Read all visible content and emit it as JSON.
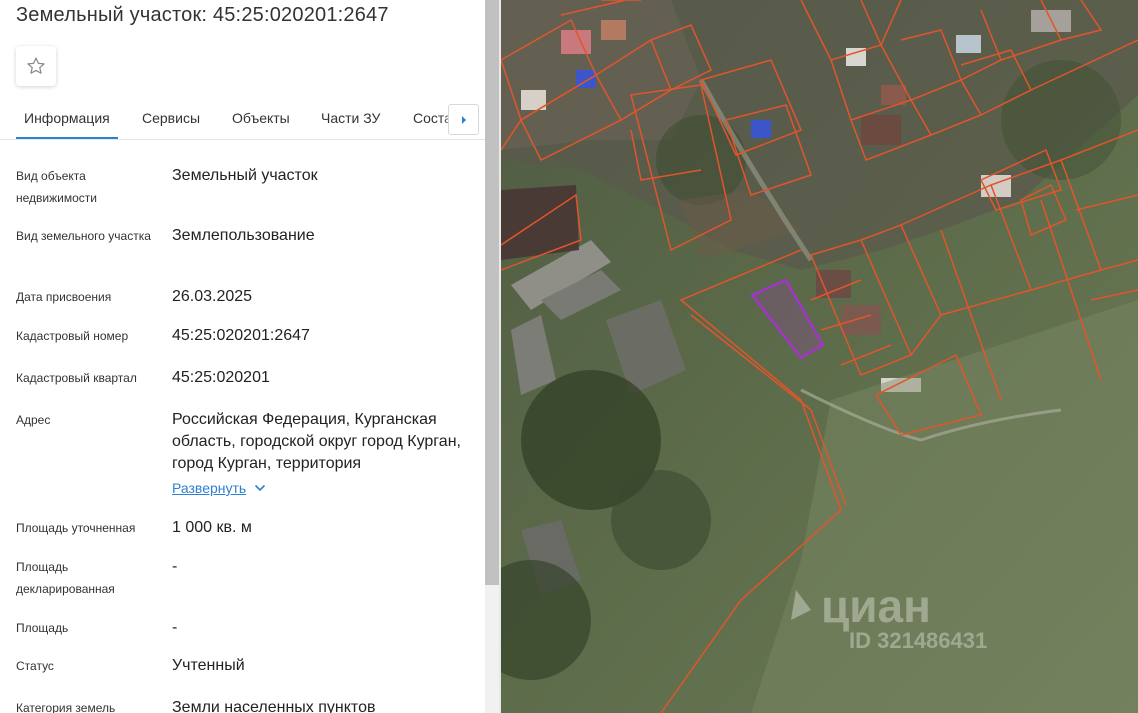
{
  "page": {
    "title": "Земельный участок: 45:25:020201:2647"
  },
  "favorite": {
    "icon": "star-icon"
  },
  "tabs": [
    {
      "label": "Информация",
      "active": true
    },
    {
      "label": "Сервисы",
      "active": false
    },
    {
      "label": "Объекты",
      "active": false
    },
    {
      "label": "Части ЗУ",
      "active": false
    },
    {
      "label": "Состав ЗУ",
      "active": false
    }
  ],
  "tabs_next": {
    "icon": "caret-right-icon"
  },
  "info": {
    "rows": [
      {
        "label": "Вид объекта недвижимости",
        "value": "Земельный участок"
      },
      {
        "label": "Вид земельного участка",
        "value": "Землепользование"
      },
      {
        "label": "Дата присвоения",
        "value": "26.03.2025"
      },
      {
        "label": "Кадастровый номер",
        "value": "45:25:020201:2647"
      },
      {
        "label": "Кадастровый квартал",
        "value": "45:25:020201"
      },
      {
        "label": "Адрес",
        "value": "Российская Федерация, Курганская область, городской округ город Курган, город Курган, территория"
      },
      {
        "label": "Площадь уточненная",
        "value": "1 000 кв. м"
      },
      {
        "label": "Площадь декларированная",
        "value": "-"
      },
      {
        "label": "Площадь",
        "value": "-"
      },
      {
        "label": "Статус",
        "value": "Учтенный"
      },
      {
        "label": "Категория земель",
        "value": "Земли населенных пунктов"
      }
    ],
    "expand_label": "Развернуть",
    "expand_icon": "chevron-down-icon"
  },
  "map": {
    "watermark_brand": "циан",
    "watermark_id": "ID 321486431",
    "parcel_highlight_color": "#b02be0",
    "boundary_color": "#e2552b"
  }
}
